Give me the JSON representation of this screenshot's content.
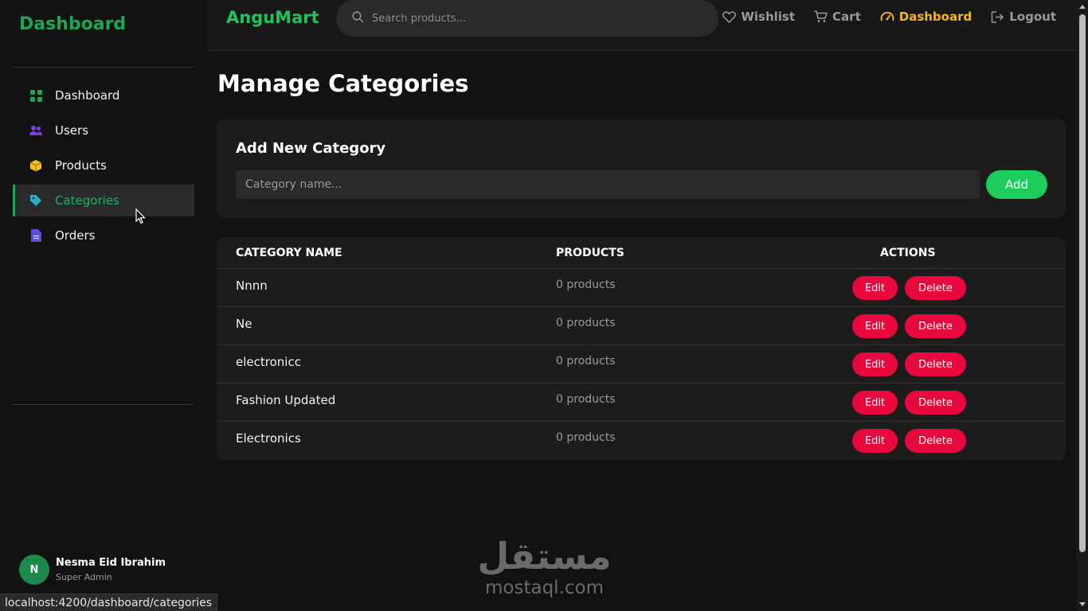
{
  "sidebar": {
    "title": "Dashboard",
    "items": [
      {
        "label": "Dashboard",
        "icon": "grid-icon",
        "color": "#1fa655"
      },
      {
        "label": "Users",
        "icon": "users-icon",
        "color": "#7b3fe4"
      },
      {
        "label": "Products",
        "icon": "box-icon",
        "color": "#f4c21b"
      },
      {
        "label": "Categories",
        "icon": "tag-icon",
        "color": "#2ab0c9",
        "active": true
      },
      {
        "label": "Orders",
        "icon": "file-icon",
        "color": "#5b4ae8"
      }
    ],
    "user": {
      "initial": "N",
      "name": "Nesma Eid Ibrahim",
      "role": "Super Admin"
    }
  },
  "topbar": {
    "brand": "AnguMart",
    "search_placeholder": "Search products...",
    "links": [
      {
        "label": "Wishlist",
        "icon": "heart-icon"
      },
      {
        "label": "Cart",
        "icon": "cart-icon"
      },
      {
        "label": "Dashboard",
        "icon": "gauge-icon",
        "active": true
      },
      {
        "label": "Logout",
        "icon": "logout-icon"
      }
    ]
  },
  "main": {
    "title": "Manage Categories",
    "add_card": {
      "title": "Add New Category",
      "input_placeholder": "Category name...",
      "add_label": "Add"
    },
    "table": {
      "headers": [
        "CATEGORY NAME",
        "PRODUCTS",
        "ACTIONS"
      ],
      "edit_label": "Edit",
      "delete_label": "Delete",
      "rows": [
        {
          "name": "Nnnn",
          "count": "0 products"
        },
        {
          "name": "Ne",
          "count": "0 products"
        },
        {
          "name": "electronicc",
          "count": "0 products"
        },
        {
          "name": "Fashion Updated",
          "count": "0 products"
        },
        {
          "name": "Electronics",
          "count": "0 products"
        }
      ]
    }
  },
  "watermark": {
    "arabic": "مستقل",
    "latin": "mostaql.com"
  },
  "status_url": "localhost:4200/dashboard/categories",
  "colors": {
    "accent_green": "#1fa655",
    "brand_green": "#1fc45e",
    "dashboard_gold": "#f4b621",
    "danger": "#e8083e",
    "add_green": "#1ccd5c"
  }
}
